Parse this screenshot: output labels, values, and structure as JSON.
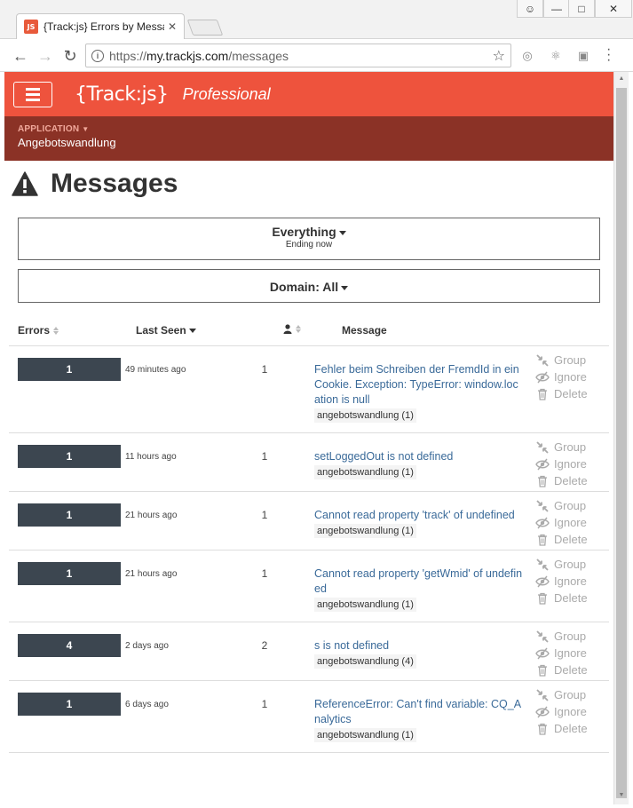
{
  "browser": {
    "tab_title": "{Track:js} Errors by Messa",
    "favicon_text": "JS",
    "url_scheme": "https://",
    "url_host": "my.trackjs.com",
    "url_path": "/messages"
  },
  "header": {
    "logo": "{Track:js}",
    "plan": "Professional"
  },
  "app_bar": {
    "label": "APPLICATION",
    "name": "Angebotswandlung"
  },
  "page": {
    "title": "Messages"
  },
  "filters": {
    "range_label": "Everything",
    "range_sub": "Ending now",
    "domain_label": "Domain:",
    "domain_value": "All"
  },
  "table": {
    "headers": {
      "errors": "Errors",
      "last_seen": "Last Seen",
      "message": "Message"
    },
    "action_labels": {
      "group": "Group",
      "ignore": "Ignore",
      "delete": "Delete"
    },
    "rows": [
      {
        "errors": "1",
        "last_seen": "49 minutes ago",
        "users": "1",
        "message": "Fehler beim Schreiben der FremdId in ein Cookie. Exception: TypeError: window.location is null",
        "tag": "angebotswandlung (1)"
      },
      {
        "errors": "1",
        "last_seen": "11 hours ago",
        "users": "1",
        "message": "setLoggedOut is not defined",
        "tag": "angebotswandlung (1)"
      },
      {
        "errors": "1",
        "last_seen": "21 hours ago",
        "users": "1",
        "message": "Cannot read property 'track' of undefined",
        "tag": "angebotswandlung (1)"
      },
      {
        "errors": "1",
        "last_seen": "21 hours ago",
        "users": "1",
        "message": "Cannot read property 'getWmid' of undefined",
        "tag": "angebotswandlung (1)"
      },
      {
        "errors": "4",
        "last_seen": "2 days ago",
        "users": "2",
        "message": "s is not defined",
        "tag": "angebotswandlung (4)"
      },
      {
        "errors": "1",
        "last_seen": "6 days ago",
        "users": "1",
        "message": "ReferenceError: Can't find variable: CQ_Analytics",
        "tag": "angebotswandlung (1)"
      }
    ]
  }
}
